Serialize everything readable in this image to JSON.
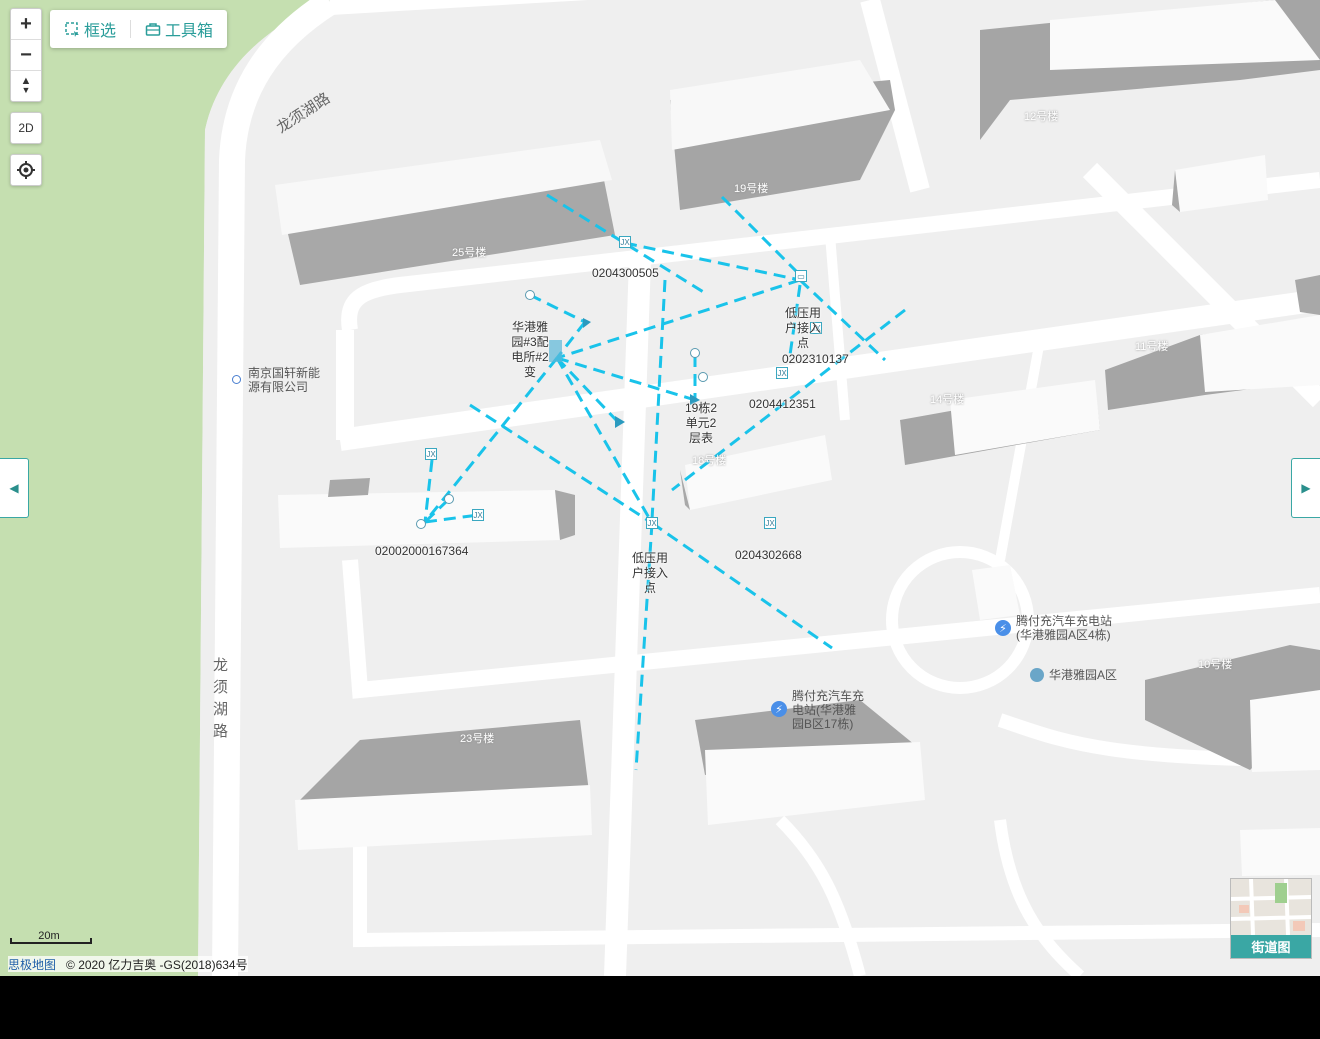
{
  "toolbar": {
    "box_select": "框选",
    "toolbox": "工具箱"
  },
  "controls": {
    "zoom_in": "+",
    "zoom_out": "−",
    "compass": "▲",
    "mode_2d": "2D",
    "locate_icon": "locate-icon"
  },
  "side_tabs": {
    "left": "◀",
    "right": "▶"
  },
  "roads": {
    "longxuhu_top": "龙须湖路",
    "longxuhu_left": "龙\n须\n湖\n路"
  },
  "buildings": {
    "b25": "25号楼",
    "b19": "19号楼",
    "b12": "12号楼",
    "b11": "11号楼",
    "b14": "14号楼",
    "b18": "18号楼",
    "b10": "10号楼",
    "b23": "23号楼"
  },
  "pois": {
    "nanjing_company": "南京国轩新能源有限公司",
    "charging_a": "腾付充汽车充电站(华港雅园A区4栋)",
    "huagang_a": "华港雅园A区",
    "charging_b": "腾付充汽车充电站(华港雅园B区17栋)"
  },
  "devices": {
    "id_0204300505": "0204300505",
    "id_0202310137": "0202310137",
    "id_0204412351": "0204412351",
    "id_02002000167364": "02002000167364",
    "id_0204302668": "0204302668",
    "substation": "华港雅园#3配电所#2变",
    "low_voltage_1": "低压用户接入点",
    "low_voltage_2": "低压用户接入点",
    "meter_box": "19栋2单元2层表"
  },
  "scale": "20m",
  "copyright": {
    "brand": "思极地图",
    "text": "© 2020 亿力吉奥 -GS(2018)634号"
  },
  "street_view": {
    "label": "街道图"
  },
  "colors": {
    "link_line": "#19c3ea",
    "accent": "#3aa7a4",
    "green_area": "#c5dfb0"
  }
}
